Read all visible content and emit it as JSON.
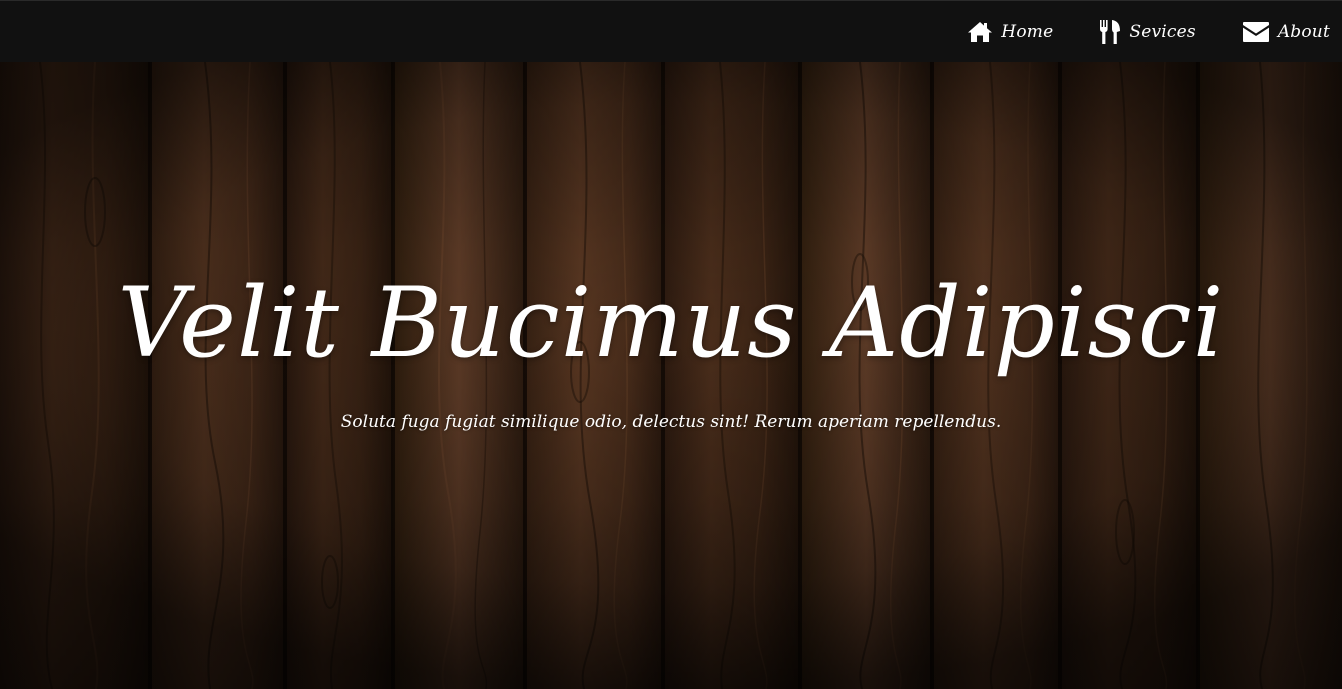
{
  "nav": {
    "items": [
      {
        "label": "Home",
        "icon": "home-icon"
      },
      {
        "label": "Sevices",
        "icon": "utensils-icon"
      },
      {
        "label": "About",
        "icon": "envelope-icon"
      }
    ]
  },
  "hero": {
    "title": "Velit Bucimus Adipisci",
    "subtitle": "Soluta fuga fugiat similique odio, delectus sint! Rerum aperiam repellendus.",
    "background": "wood-planks"
  },
  "colors": {
    "navbar": "#111111",
    "text": "#ffffff",
    "wood_dark": "#2a180e",
    "wood_mid": "#4a2d1b",
    "wood_light": "#6b4329"
  }
}
